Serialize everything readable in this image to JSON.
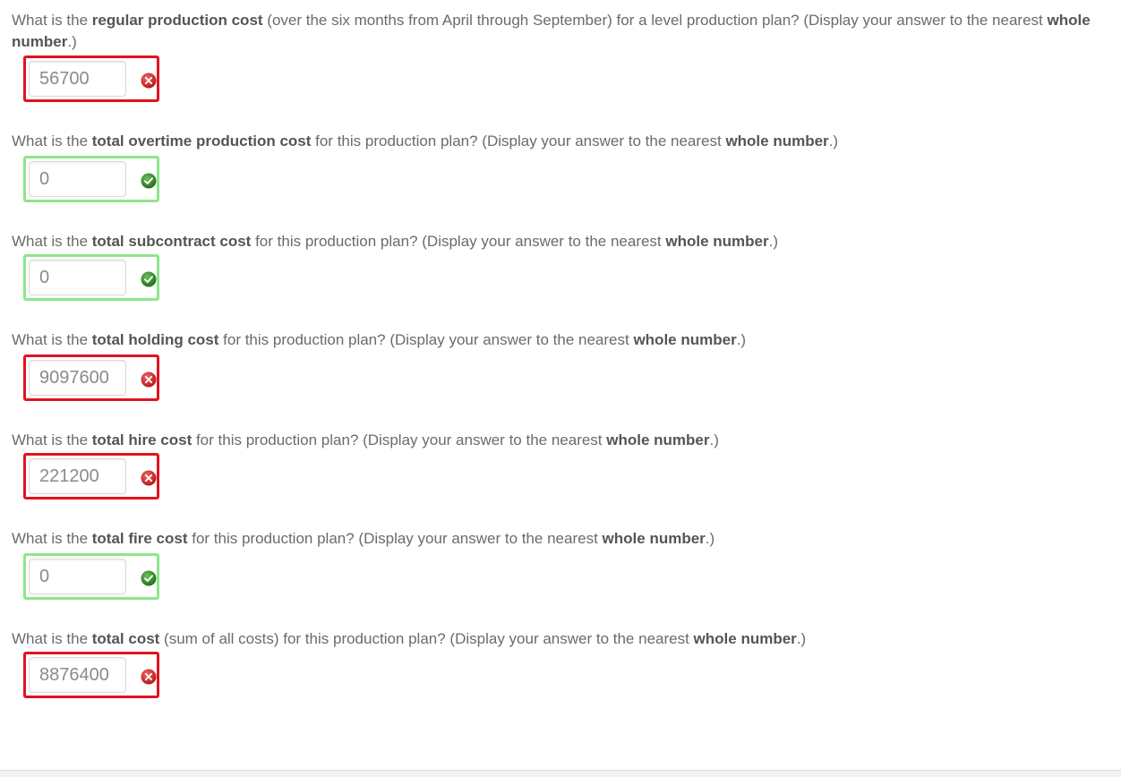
{
  "questions": [
    {
      "parts": [
        {
          "text": "What is the ",
          "bold": false
        },
        {
          "text": "regular production cost",
          "bold": true
        },
        {
          "text": " (over the six months from April through September) for a level production plan? (Display your answer to the nearest ",
          "bold": false
        },
        {
          "text": "whole number",
          "bold": true
        },
        {
          "text": ".)",
          "bold": false
        }
      ],
      "answer": "56700",
      "status": "incorrect"
    },
    {
      "parts": [
        {
          "text": "What is the ",
          "bold": false
        },
        {
          "text": "total overtime production cost",
          "bold": true
        },
        {
          "text": " for this production plan? (Display your answer to the nearest ",
          "bold": false
        },
        {
          "text": "whole number",
          "bold": true
        },
        {
          "text": ".)",
          "bold": false
        }
      ],
      "answer": "0",
      "status": "correct"
    },
    {
      "parts": [
        {
          "text": "What is the ",
          "bold": false
        },
        {
          "text": "total subcontract cost",
          "bold": true
        },
        {
          "text": " for this production plan? (Display your answer to the nearest ",
          "bold": false
        },
        {
          "text": "whole number",
          "bold": true
        },
        {
          "text": ".)",
          "bold": false
        }
      ],
      "answer": "0",
      "status": "correct"
    },
    {
      "parts": [
        {
          "text": "What is the ",
          "bold": false
        },
        {
          "text": "total holding cost",
          "bold": true
        },
        {
          "text": " for this production plan? (Display your answer to the nearest ",
          "bold": false
        },
        {
          "text": "whole number",
          "bold": true
        },
        {
          "text": ".)",
          "bold": false
        }
      ],
      "answer": "9097600",
      "status": "incorrect"
    },
    {
      "parts": [
        {
          "text": "What is the ",
          "bold": false
        },
        {
          "text": "total hire cost",
          "bold": true
        },
        {
          "text": " for this production plan? (Display your answer to the nearest ",
          "bold": false
        },
        {
          "text": "whole number",
          "bold": true
        },
        {
          "text": ".)",
          "bold": false
        }
      ],
      "answer": "221200",
      "status": "incorrect"
    },
    {
      "parts": [
        {
          "text": "What is the ",
          "bold": false
        },
        {
          "text": "total fire cost",
          "bold": true
        },
        {
          "text": " for this production plan? (Display your answer to the nearest ",
          "bold": false
        },
        {
          "text": "whole number",
          "bold": true
        },
        {
          "text": ".)",
          "bold": false
        }
      ],
      "answer": "0",
      "status": "correct"
    },
    {
      "parts": [
        {
          "text": "What is the ",
          "bold": false
        },
        {
          "text": "total cost",
          "bold": true
        },
        {
          "text": " (sum of all costs) for this production plan? (Display your answer to the nearest ",
          "bold": false
        },
        {
          "text": "whole number",
          "bold": true
        },
        {
          "text": ".)",
          "bold": false
        }
      ],
      "answer": "8876400",
      "status": "incorrect"
    }
  ],
  "status_icons": {
    "incorrect": "x-circle-icon",
    "correct": "check-circle-icon"
  },
  "colors": {
    "incorrect_border": "#e3121f",
    "correct_border": "#8ee68a",
    "incorrect_icon": "#d42a2a",
    "correct_icon": "#2f8a24"
  }
}
